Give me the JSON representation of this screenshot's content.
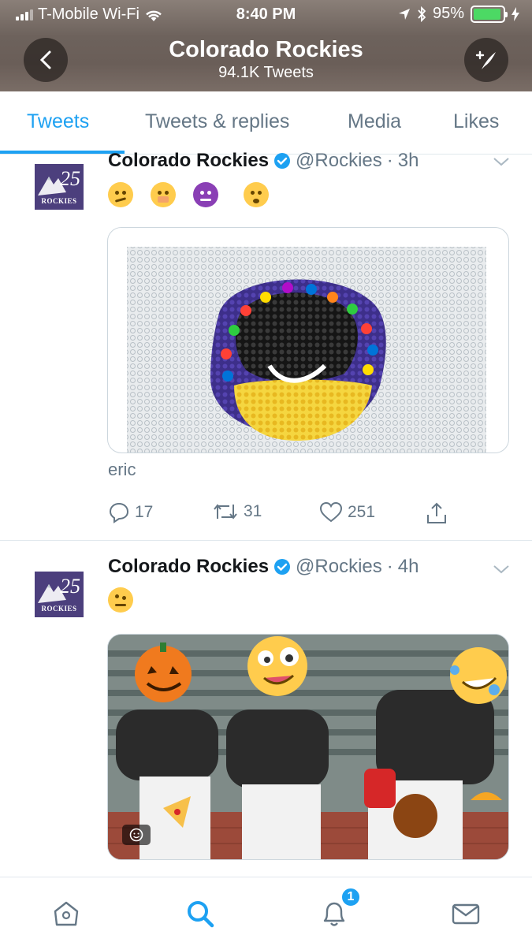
{
  "status_bar": {
    "carrier": "T-Mobile Wi-Fi",
    "time": "8:40 PM",
    "battery_percent": "95%",
    "battery_level": 0.95
  },
  "header": {
    "title": "Colorado Rockies",
    "subtitle": "94.1K Tweets"
  },
  "tabs": [
    {
      "label": "Tweets",
      "active": true
    },
    {
      "label": "Tweets & replies",
      "active": false
    },
    {
      "label": "Media",
      "active": false
    },
    {
      "label": "Likes",
      "active": false
    }
  ],
  "tweets": [
    {
      "name": "Colorado Rockies",
      "handle": "@Rockies",
      "separator": "·",
      "time": "3h",
      "emojis": [
        "thinking-face-emoji",
        "face-with-hand-over-mouth-emoji",
        "smiling-face-with-horns-emoji",
        "exploding-head-emoji"
      ],
      "caption": "eric",
      "replies": "17",
      "retweets": "31",
      "likes": "251"
    },
    {
      "name": "Colorado Rockies",
      "handle": "@Rockies",
      "separator": "·",
      "time": "4h",
      "emojis": [
        "face-with-raised-eyebrow-emoji"
      ]
    }
  ],
  "avatar": {
    "number": "25",
    "label": "ROCKIES"
  },
  "bottom_nav": {
    "notification_count": "1"
  },
  "colors": {
    "accent": "#1da1f2",
    "rockies_purple": "#4c3f7d",
    "muted": "#657786",
    "divider": "#e1e8ed"
  }
}
